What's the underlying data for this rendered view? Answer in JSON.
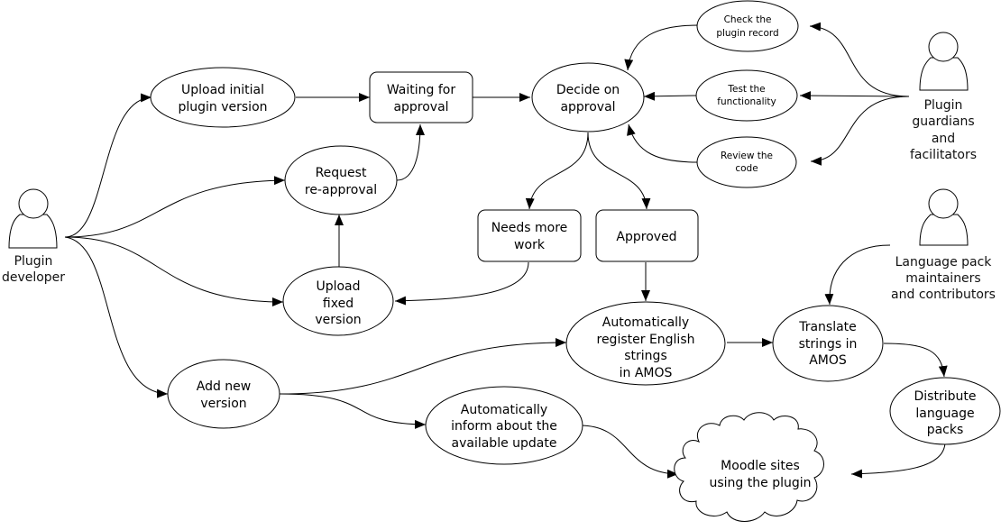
{
  "actors": {
    "developer": [
      "Plugin",
      "developer"
    ],
    "guardians": [
      "Plugin",
      "guardians",
      "and",
      "facilitators"
    ],
    "language": [
      "Language pack",
      "maintainers",
      "and contributors"
    ]
  },
  "nodes": {
    "upload_initial": [
      "Upload initial",
      "plugin version"
    ],
    "waiting": [
      "Waiting for",
      "approval"
    ],
    "decide": [
      "Decide on",
      "approval"
    ],
    "check_record": [
      "Check the",
      "plugin record"
    ],
    "test_func": [
      "Test the",
      "functionality"
    ],
    "review_code": [
      "Review the",
      "code"
    ],
    "request_reapproval": [
      "Request",
      "re-approval"
    ],
    "needs_work": [
      "Needs more",
      "work"
    ],
    "approved": [
      "Approved"
    ],
    "upload_fixed": [
      "Upload",
      "fixed",
      "version"
    ],
    "register_strings": [
      "Automatically",
      "register English",
      "strings",
      "in AMOS"
    ],
    "translate": [
      "Translate",
      "strings in",
      "AMOS"
    ],
    "distribute": [
      "Distribute",
      "language",
      "packs"
    ],
    "add_version": [
      "Add new",
      "version"
    ],
    "inform_update": [
      "Automatically",
      "inform about the",
      "available update"
    ],
    "moodle_sites": [
      "Moodle sites",
      "using the plugin"
    ]
  }
}
